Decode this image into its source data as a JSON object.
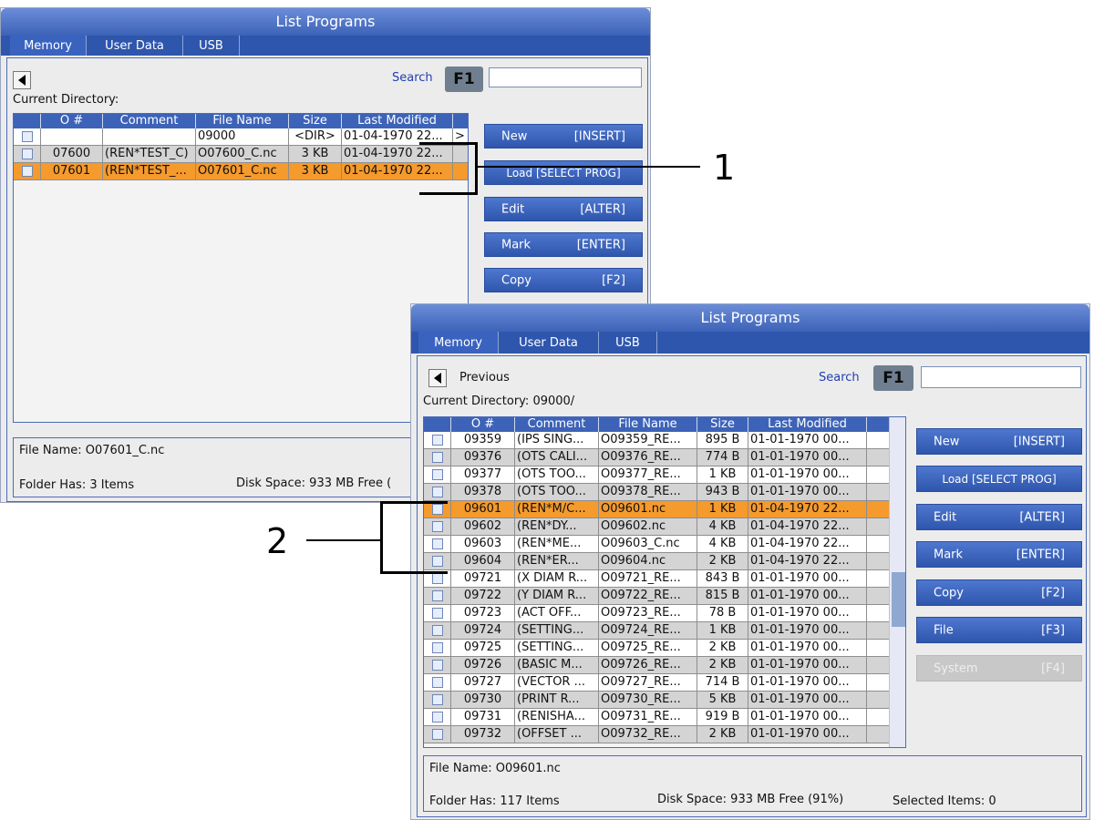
{
  "window1": {
    "title": "List Programs",
    "tabs": [
      {
        "label": "Memory"
      },
      {
        "label": "User Data"
      },
      {
        "label": "USB"
      }
    ],
    "search_label": "Search",
    "search_key": "F1",
    "search_value": "",
    "current_directory": "Current Directory:",
    "columns": [
      "O #",
      "Comment",
      "File Name",
      "Size",
      "Last Modified"
    ],
    "rows": [
      {
        "o": "",
        "comment": "",
        "file": "09000",
        "size": "<DIR>",
        "modified": "01-04-1970 22...",
        "extra": ">"
      },
      {
        "o": "07600",
        "comment": "(REN*TEST_C)",
        "file": "O07600_C.nc",
        "size": "3 KB",
        "modified": "01-04-1970 22...",
        "extra": ""
      },
      {
        "o": "07601",
        "comment": "(REN*TEST_...",
        "file": "O07601_C.nc",
        "size": "3 KB",
        "modified": "01-04-1970 22...",
        "extra": ""
      }
    ],
    "buttons": [
      {
        "label": "New",
        "key": "[INSERT]"
      },
      {
        "label": "Load [SELECT PROG]",
        "key": ""
      },
      {
        "label": "Edit",
        "key": "[ALTER]"
      },
      {
        "label": "Mark",
        "key": "[ENTER]"
      },
      {
        "label": "Copy",
        "key": "[F2]"
      }
    ],
    "status": {
      "file_name": "File Name: O07601_C.nc",
      "folder_has": "Folder Has: 3 Items",
      "disk_space": "Disk Space: 933 MB Free ("
    }
  },
  "window2": {
    "title": "List Programs",
    "tabs": [
      {
        "label": "Memory"
      },
      {
        "label": "User Data"
      },
      {
        "label": "USB"
      }
    ],
    "previous_label": "Previous",
    "search_label": "Search",
    "search_key": "F1",
    "search_value": "",
    "current_directory": "Current Directory: 09000/",
    "columns": [
      "O #",
      "Comment",
      "File Name",
      "Size",
      "Last Modified"
    ],
    "rows": [
      {
        "o": "09359",
        "comment": "(IPS SING...",
        "file": "O09359_RE...",
        "size": "895 B",
        "modified": "01-01-1970 00..."
      },
      {
        "o": "09376",
        "comment": "(OTS CALI...",
        "file": "O09376_RE...",
        "size": "774 B",
        "modified": "01-01-1970 00..."
      },
      {
        "o": "09377",
        "comment": "(OTS TOO...",
        "file": "O09377_RE...",
        "size": "1 KB",
        "modified": "01-01-1970 00..."
      },
      {
        "o": "09378",
        "comment": "(OTS TOO...",
        "file": "O09378_RE...",
        "size": "943 B",
        "modified": "01-01-1970 00..."
      },
      {
        "o": "09601",
        "comment": "(REN*M/C...",
        "file": "O09601.nc",
        "size": "1 KB",
        "modified": "01-04-1970 22..."
      },
      {
        "o": "09602",
        "comment": "(REN*DY...",
        "file": "O09602.nc",
        "size": "4 KB",
        "modified": "01-04-1970 22..."
      },
      {
        "o": "09603",
        "comment": "(REN*ME...",
        "file": "O09603_C.nc",
        "size": "4 KB",
        "modified": "01-04-1970 22..."
      },
      {
        "o": "09604",
        "comment": "(REN*ER...",
        "file": "O09604.nc",
        "size": "2 KB",
        "modified": "01-04-1970 22..."
      },
      {
        "o": "09721",
        "comment": "(X DIAM R...",
        "file": "O09721_RE...",
        "size": "843 B",
        "modified": "01-01-1970 00..."
      },
      {
        "o": "09722",
        "comment": "(Y DIAM R...",
        "file": "O09722_RE...",
        "size": "815 B",
        "modified": "01-01-1970 00..."
      },
      {
        "o": "09723",
        "comment": "(ACT OFF...",
        "file": "O09723_RE...",
        "size": "78 B",
        "modified": "01-01-1970 00..."
      },
      {
        "o": "09724",
        "comment": "(SETTING...",
        "file": "O09724_RE...",
        "size": "1 KB",
        "modified": "01-01-1970 00..."
      },
      {
        "o": "09725",
        "comment": "(SETTING...",
        "file": "O09725_RE...",
        "size": "2 KB",
        "modified": "01-01-1970 00..."
      },
      {
        "o": "09726",
        "comment": "(BASIC M...",
        "file": "O09726_RE...",
        "size": "2 KB",
        "modified": "01-01-1970 00..."
      },
      {
        "o": "09727",
        "comment": "(VECTOR ...",
        "file": "O09727_RE...",
        "size": "714 B",
        "modified": "01-01-1970 00..."
      },
      {
        "o": "09730",
        "comment": "(PRINT R...",
        "file": "O09730_RE...",
        "size": "5 KB",
        "modified": "01-01-1970 00..."
      },
      {
        "o": "09731",
        "comment": "(RENISHA...",
        "file": "O09731_RE...",
        "size": "919 B",
        "modified": "01-01-1970 00..."
      },
      {
        "o": "09732",
        "comment": "(OFFSET ...",
        "file": "O09732_RE...",
        "size": "2 KB",
        "modified": "01-01-1970 00..."
      }
    ],
    "buttons": [
      {
        "label": "New",
        "key": "[INSERT]"
      },
      {
        "label": "Load [SELECT PROG]",
        "key": ""
      },
      {
        "label": "Edit",
        "key": "[ALTER]"
      },
      {
        "label": "Mark",
        "key": "[ENTER]"
      },
      {
        "label": "Copy",
        "key": "[F2]"
      },
      {
        "label": "File",
        "key": "[F3]"
      },
      {
        "label": "System",
        "key": "[F4]"
      }
    ],
    "status": {
      "file_name": "File Name: O09601.nc",
      "folder_has": "Folder Has: 117 Items",
      "disk_space": "Disk Space: 933 MB Free (91%)",
      "selected_items": "Selected Items: 0"
    }
  },
  "callouts": {
    "one": "1",
    "two": "2"
  }
}
